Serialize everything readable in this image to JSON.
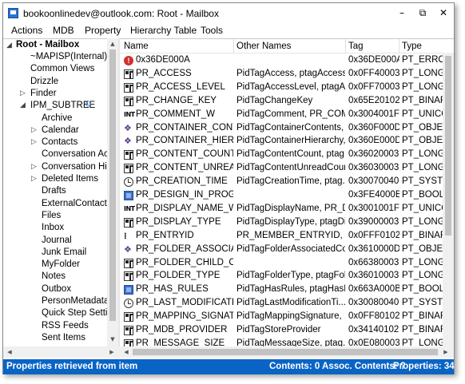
{
  "window": {
    "title": "bookoonlinedev@outlook.com: Root - Mailbox",
    "controls": {
      "minimize": "–",
      "restore": "⧉",
      "close": "✕"
    }
  },
  "menu": [
    "Actions",
    "MDB",
    "Property",
    "Hierarchy Table",
    "Tools"
  ],
  "tree": {
    "root": "Root - Mailbox",
    "items": [
      {
        "label": "~MAPISP(Internal)",
        "expandable": false
      },
      {
        "label": "Common Views",
        "expandable": false
      },
      {
        "label": "Drizzle",
        "expandable": false
      },
      {
        "label": "Finder",
        "expandable": true
      },
      {
        "label": "IPM_SUBTREE",
        "expandable": true,
        "expanded": true,
        "sync_icon": "sync-icon"
      },
      {
        "label": "Archive",
        "expandable": false
      },
      {
        "label": "Calendar",
        "expandable": true
      },
      {
        "label": "Contacts",
        "expandable": true
      },
      {
        "label": "Conversation Acti",
        "expandable": false
      },
      {
        "label": "Conversation Hist",
        "expandable": true
      },
      {
        "label": "Deleted Items",
        "expandable": true
      },
      {
        "label": "Drafts",
        "expandable": false
      },
      {
        "label": "ExternalContacts",
        "expandable": false
      },
      {
        "label": "Files",
        "expandable": false
      },
      {
        "label": "Inbox",
        "expandable": false
      },
      {
        "label": "Journal",
        "expandable": false
      },
      {
        "label": "Junk Email",
        "expandable": false
      },
      {
        "label": "MyFolder",
        "expandable": false
      },
      {
        "label": "Notes",
        "expandable": false
      },
      {
        "label": "Outbox",
        "expandable": false
      },
      {
        "label": "PersonMetadata",
        "expandable": false
      },
      {
        "label": "Quick Step Setting",
        "expandable": false
      },
      {
        "label": "RSS Feeds",
        "expandable": false
      },
      {
        "label": "Sent Items",
        "expandable": false
      }
    ]
  },
  "columns": {
    "name": "Name",
    "other_names": "Other Names",
    "tag": "Tag",
    "type": "Type"
  },
  "rows": [
    {
      "icon": "error-icon",
      "name": "0x36DE000A",
      "other": "",
      "tag": "0x36DE000A",
      "type": "PT_ERROR"
    },
    {
      "icon": "grid-icon",
      "name": "PR_ACCESS",
      "other": "PidTagAccess, ptagAccess",
      "tag": "0x0FF40003",
      "type": "PT_LONG"
    },
    {
      "icon": "grid-icon",
      "name": "PR_ACCESS_LEVEL",
      "other": "PidTagAccessLevel, ptagAc...",
      "tag": "0x0FF70003",
      "type": "PT_LONG"
    },
    {
      "icon": "grid-icon",
      "name": "PR_CHANGE_KEY",
      "other": "PidTagChangeKey",
      "tag": "0x65E20102",
      "type": "PT_BINARY"
    },
    {
      "icon": "int-icon",
      "name": "PR_COMMENT_W",
      "other": "PidTagComment, PR_COM...",
      "tag": "0x3004001F",
      "type": "PT_UNICODE"
    },
    {
      "icon": "object-icon",
      "name": "PR_CONTAINER_CONTE...",
      "other": "PidTagContainerContents, ...",
      "tag": "0x360F000D",
      "type": "PT_OBJECT"
    },
    {
      "icon": "object-icon",
      "name": "PR_CONTAINER_HIERAR...",
      "other": "PidTagContainerHierarchy, ...",
      "tag": "0x360E000D",
      "type": "PT_OBJECT"
    },
    {
      "icon": "grid-icon",
      "name": "PR_CONTENT_COUNT",
      "other": "PidTagContentCount, ptag...",
      "tag": "0x36020003",
      "type": "PT_LONG"
    },
    {
      "icon": "grid-icon",
      "name": "PR_CONTENT_UNREAD",
      "other": "PidTagContentUnreadCoun...",
      "tag": "0x36030003",
      "type": "PT_LONG"
    },
    {
      "icon": "clock-icon",
      "name": "PR_CREATION_TIME",
      "other": "PidTagCreationTime, ptag...",
      "tag": "0x30070040",
      "type": "PT_SYSTIME"
    },
    {
      "icon": "boolean-icon",
      "name": "PR_DESIGN_IN_PROGRE...",
      "other": "",
      "tag": "0x3FE4000B",
      "type": "PT_BOOLEAN"
    },
    {
      "icon": "int-icon",
      "name": "PR_DISPLAY_NAME_W",
      "other": "PidTagDisplayName, PR_DI...",
      "tag": "0x3001001F",
      "type": "PT_UNICODE"
    },
    {
      "icon": "grid-icon",
      "name": "PR_DISPLAY_TYPE",
      "other": "PidTagDisplayType, ptagDi...",
      "tag": "0x39000003",
      "type": "PT_LONG"
    },
    {
      "icon": "binary-icon",
      "name": "PR_ENTRYID",
      "other": "PR_MEMBER_ENTRYID, Pid...",
      "tag": "0x0FFF0102",
      "type": "PT_BINARY"
    },
    {
      "icon": "object-icon",
      "name": "PR_FOLDER_ASSOCIATE...",
      "other": "PidTagFolderAssociatedCo...",
      "tag": "0x3610000D",
      "type": "PT_OBJECT"
    },
    {
      "icon": "grid-icon",
      "name": "PR_FOLDER_CHILD_COU...",
      "other": "",
      "tag": "0x66380003",
      "type": "PT_LONG"
    },
    {
      "icon": "grid-icon",
      "name": "PR_FOLDER_TYPE",
      "other": "PidTagFolderType, ptagFol...",
      "tag": "0x36010003",
      "type": "PT_LONG"
    },
    {
      "icon": "boolean-icon",
      "name": "PR_HAS_RULES",
      "other": "PidTagHasRules, ptagHasR...",
      "tag": "0x663A000B",
      "type": "PT_BOOLEAN"
    },
    {
      "icon": "clock-icon",
      "name": "PR_LAST_MODIFICATIO...",
      "other": "PidTagLastModificationTi...",
      "tag": "0x30080040",
      "type": "PT_SYSTIME"
    },
    {
      "icon": "grid-icon",
      "name": "PR_MAPPING_SIGNATURE",
      "other": "PidTagMappingSignature, ...",
      "tag": "0x0FF80102",
      "type": "PT_BINARY"
    },
    {
      "icon": "grid-icon",
      "name": "PR_MDB_PROVIDER",
      "other": "PidTagStoreProvider",
      "tag": "0x34140102",
      "type": "PT_BINARY"
    },
    {
      "icon": "grid-icon",
      "name": "PR_MESSAGE_SIZE",
      "other": "PidTagMessageSize, ptag...",
      "tag": "0x0E080003",
      "type": "PT_LONG"
    }
  ],
  "status": {
    "message": "Properties retrieved from item",
    "contents": "Contents: 0 Assoc. Contents: ?",
    "properties": "Properties: 34"
  }
}
